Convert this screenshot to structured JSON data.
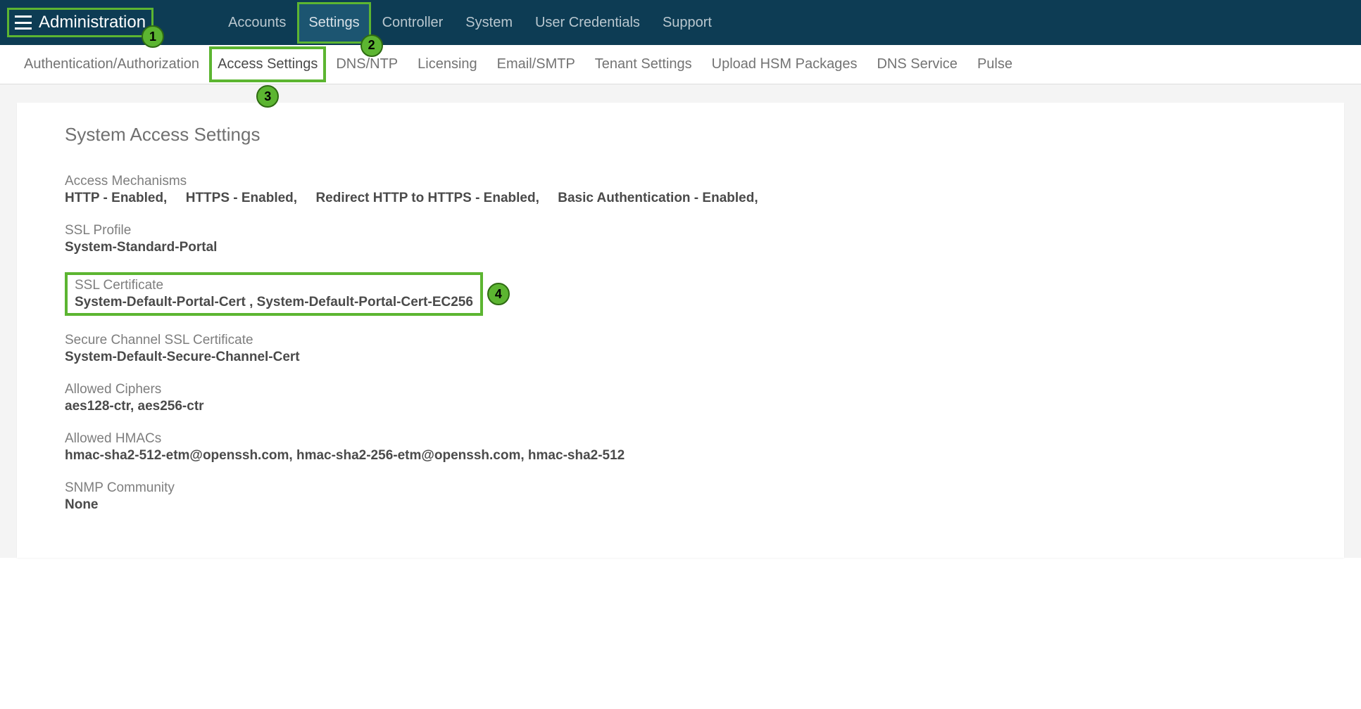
{
  "header": {
    "title": "Administration",
    "nav": [
      {
        "label": "Accounts",
        "active": false
      },
      {
        "label": "Settings",
        "active": true
      },
      {
        "label": "Controller",
        "active": false
      },
      {
        "label": "System",
        "active": false
      },
      {
        "label": "User Credentials",
        "active": false
      },
      {
        "label": "Support",
        "active": false
      }
    ]
  },
  "subnav": [
    {
      "label": "Authentication/Authorization",
      "active": false
    },
    {
      "label": "Access Settings",
      "active": true
    },
    {
      "label": "DNS/NTP",
      "active": false
    },
    {
      "label": "Licensing",
      "active": false
    },
    {
      "label": "Email/SMTP",
      "active": false
    },
    {
      "label": "Tenant Settings",
      "active": false
    },
    {
      "label": "Upload HSM Packages",
      "active": false
    },
    {
      "label": "DNS Service",
      "active": false
    },
    {
      "label": "Pulse",
      "active": false
    }
  ],
  "callouts": {
    "n1": "1",
    "n2": "2",
    "n3": "3",
    "n4": "4"
  },
  "page": {
    "title": "System Access Settings",
    "access_mechanisms": {
      "label": "Access Mechanisms",
      "value": "HTTP - Enabled,     HTTPS - Enabled,     Redirect HTTP to HTTPS - Enabled,     Basic Authentication - Enabled,"
    },
    "ssl_profile": {
      "label": "SSL Profile",
      "value": "System-Standard-Portal"
    },
    "ssl_certificate": {
      "label": "SSL Certificate",
      "value": "System-Default-Portal-Cert , System-Default-Portal-Cert-EC256"
    },
    "secure_channel_ssl_certificate": {
      "label": "Secure Channel SSL Certificate",
      "value": "System-Default-Secure-Channel-Cert"
    },
    "allowed_ciphers": {
      "label": "Allowed Ciphers",
      "value": "aes128-ctr, aes256-ctr"
    },
    "allowed_hmacs": {
      "label": "Allowed HMACs",
      "value": "hmac-sha2-512-etm@openssh.com, hmac-sha2-256-etm@openssh.com, hmac-sha2-512"
    },
    "snmp_community": {
      "label": "SNMP Community",
      "value": "None"
    }
  }
}
